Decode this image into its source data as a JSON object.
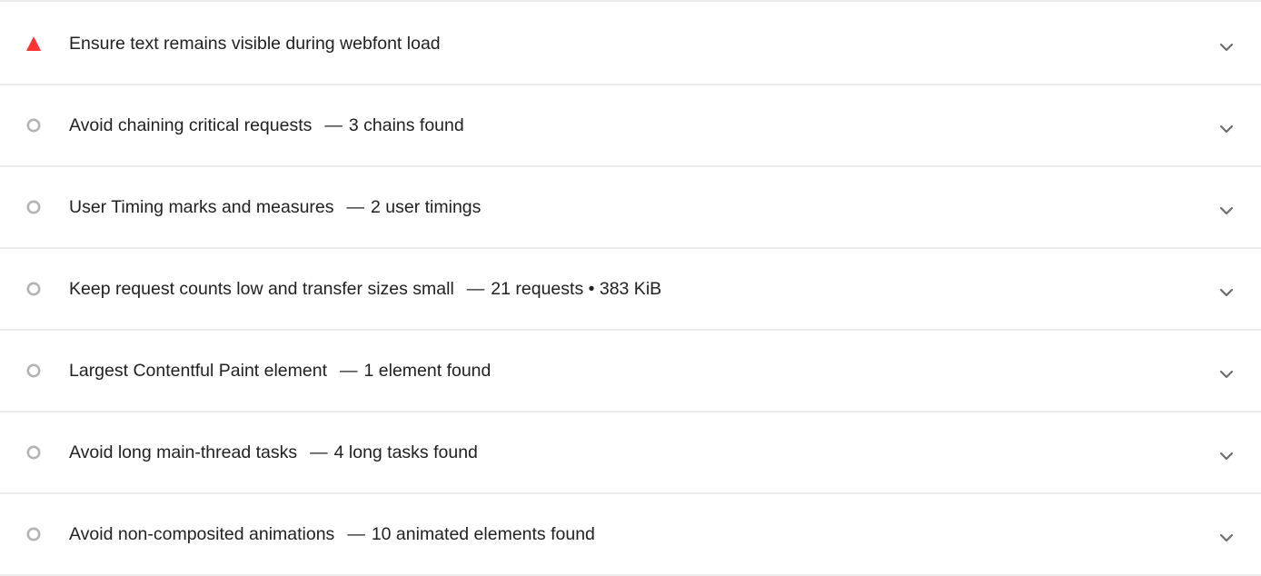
{
  "colors": {
    "fail": "#f33",
    "informative": "#b3b3b3",
    "divider": "#ebebeb",
    "text": "#212121",
    "chevron": "#6e6e6e"
  },
  "audits": [
    {
      "status": "fail",
      "icon": "red-triangle-icon",
      "title": "Ensure text remains visible during webfont load",
      "separator": "",
      "display_value": ""
    },
    {
      "status": "informative",
      "icon": "gray-circle-icon",
      "title": "Avoid chaining critical requests",
      "separator": "—",
      "display_value": "3 chains found"
    },
    {
      "status": "informative",
      "icon": "gray-circle-icon",
      "title": "User Timing marks and measures",
      "separator": "—",
      "display_value": "2 user timings"
    },
    {
      "status": "informative",
      "icon": "gray-circle-icon",
      "title": "Keep request counts low and transfer sizes small",
      "separator": "—",
      "display_value": "21 requests • 383 KiB"
    },
    {
      "status": "informative",
      "icon": "gray-circle-icon",
      "title": "Largest Contentful Paint element",
      "separator": "—",
      "display_value": "1 element found"
    },
    {
      "status": "informative",
      "icon": "gray-circle-icon",
      "title": "Avoid long main-thread tasks",
      "separator": "—",
      "display_value": "4 long tasks found"
    },
    {
      "status": "informative",
      "icon": "gray-circle-icon",
      "title": "Avoid non-composited animations",
      "separator": "—",
      "display_value": "10 animated elements found"
    }
  ]
}
